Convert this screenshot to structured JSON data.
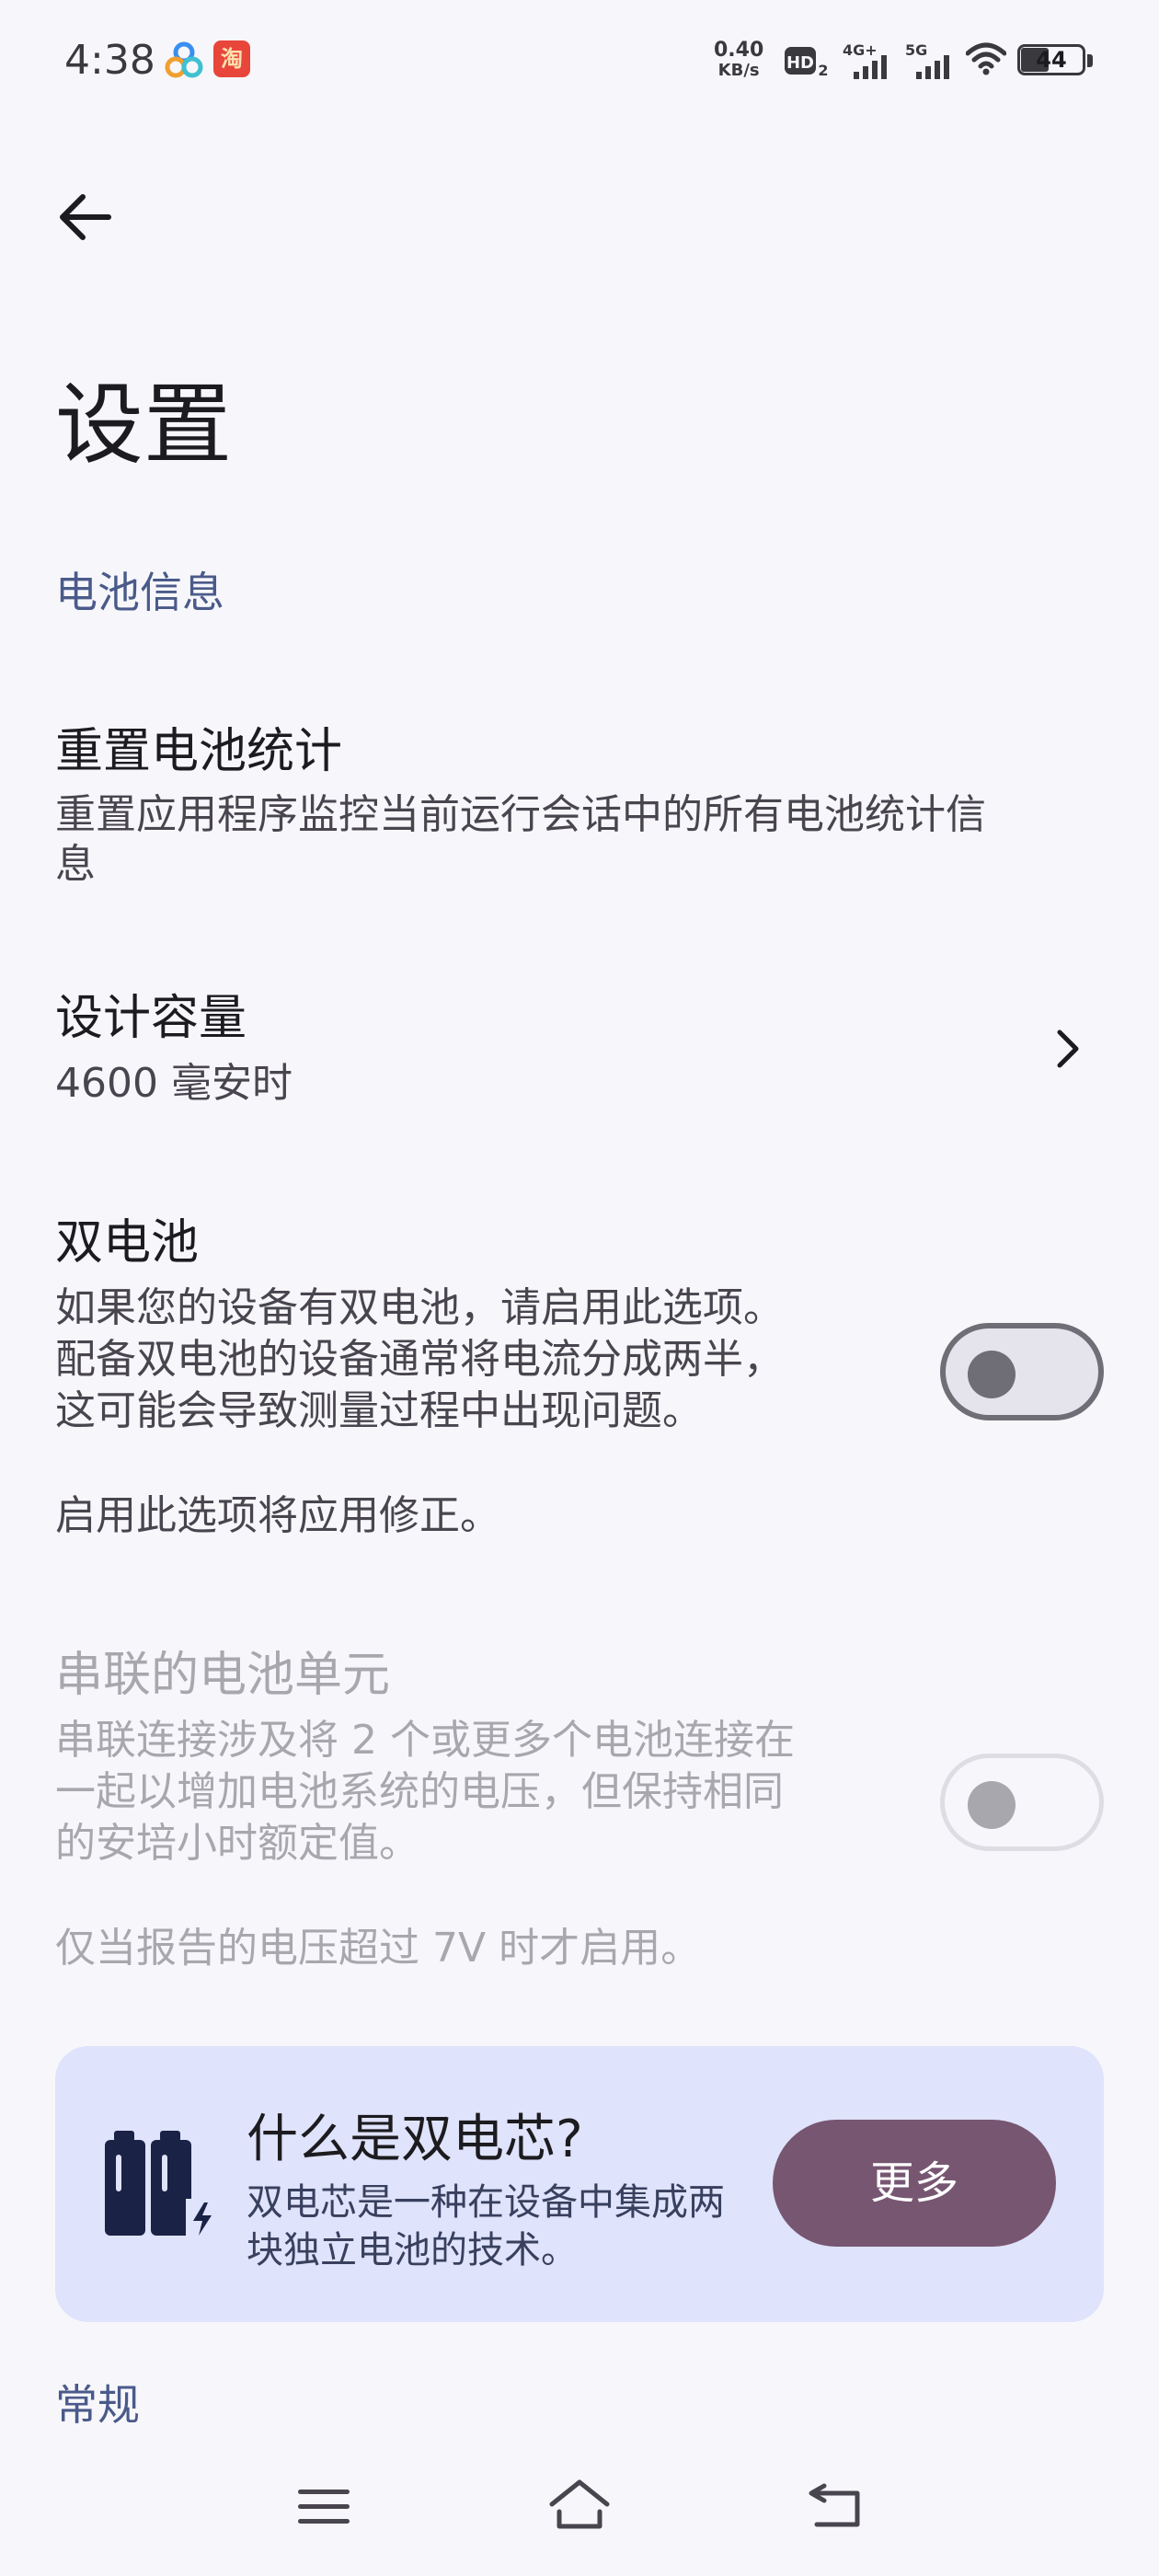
{
  "status_bar": {
    "time": "4:38",
    "net_speed_value": "0.40",
    "net_speed_unit": "KB/s",
    "hd_label": "HD",
    "signal_1_label": "4G+",
    "signal_2_label": "5G",
    "battery_level": "44",
    "taobao_label": "淘"
  },
  "header": {
    "title": "设置"
  },
  "sections": {
    "battery_info": "电池信息",
    "general": "常规"
  },
  "items": {
    "reset_stats": {
      "title": "重置电池统计",
      "subtitle_line1": "重置应用程序监控当前运行会话中的所有电池统计信",
      "subtitle_line2": "息"
    },
    "design_capacity": {
      "title": "设计容量",
      "value": "4600 毫安时"
    },
    "dual_battery": {
      "title": "双电池",
      "line1": "如果您的设备有双电池，请启用此选项。",
      "line2": "配备双电池的设备通常将电流分成两半，",
      "line3": "这可能会导致测量过程中出现问题。",
      "note": "启用此选项将应用修正。",
      "enabled": false
    },
    "series_cells": {
      "title": "串联的电池单元",
      "line1": "串联连接涉及将 2 个或更多个电池连接在",
      "line2": "一起以增加电池系统的电压，但保持相同",
      "line3": "的安培小时额定值。",
      "note": "仅当报告的电压超过 7V 时才启用。",
      "enabled": false
    }
  },
  "info_card": {
    "title": "什么是双电芯?",
    "desc_line1": "双电芯是一种在设备中集成两",
    "desc_line2": "块独立电池的技术。",
    "button_label": "更多",
    "icon": "dual-battery-icon"
  },
  "colors": {
    "background": "#f7f7fb",
    "section_header": "#4a5a8a",
    "card_background": "#dfe3fb",
    "button_background": "#775672",
    "disabled_text": "#a8a7ad"
  }
}
